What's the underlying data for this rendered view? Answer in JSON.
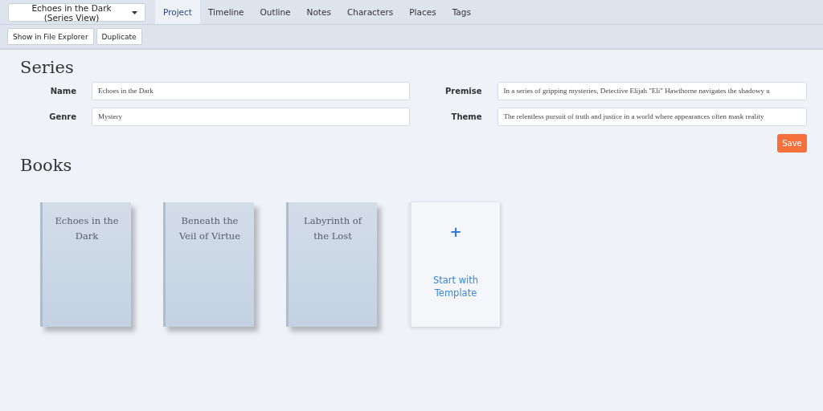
{
  "project_selector": {
    "label": "Echoes in the Dark (Series View)"
  },
  "tabs": [
    {
      "label": "Project",
      "selected": true
    },
    {
      "label": "Timeline",
      "selected": false
    },
    {
      "label": "Outline",
      "selected": false
    },
    {
      "label": "Notes",
      "selected": false
    },
    {
      "label": "Characters",
      "selected": false
    },
    {
      "label": "Places",
      "selected": false
    },
    {
      "label": "Tags",
      "selected": false
    }
  ],
  "toolbar": [
    "Show in File Explorer",
    "Duplicate"
  ],
  "series": {
    "heading": "Series",
    "fields": [
      {
        "label": "Name",
        "value": "Echoes in the Dark"
      },
      {
        "label": "Premise",
        "value": "In a series of gripping mysteries, Detective Elijah \"Eli\" Hawthorne navigates the shadowy u"
      },
      {
        "label": "Genre",
        "value": "Mystery"
      },
      {
        "label": "Theme",
        "value": "The relentless pursuit of truth and justice in a world where appearances often mask reality"
      }
    ],
    "save": "Save"
  },
  "books": {
    "heading": "Books",
    "items": [
      {
        "title": "Echoes in the Dark"
      },
      {
        "title": "Beneath the Veil of Virtue"
      },
      {
        "title": "Labyrinth of the Lost"
      }
    ],
    "template": {
      "icon": "+",
      "label": "Start with Template"
    }
  }
}
